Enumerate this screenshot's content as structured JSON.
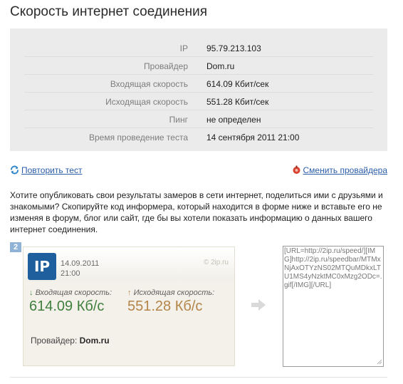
{
  "page": {
    "title": "Скорость интернет соединения"
  },
  "results": [
    {
      "label": "IP",
      "value": "95.79.213.103"
    },
    {
      "label": "Провайдер",
      "value": "Dom.ru"
    },
    {
      "label": "Входящая скорость",
      "value": "614.09 Кбит/сек"
    },
    {
      "label": "Исходящая скорость",
      "value": "551.28 Кбит/сек"
    },
    {
      "label": "Пинг",
      "value": "не определен"
    },
    {
      "label": "Время проведение теста",
      "value": "14 сентября 2011 21:00"
    }
  ],
  "links": {
    "retest": "Повторить тест",
    "change_provider": "Сменить провайдера"
  },
  "description": "Хотите опубликовать свои результаты замеров в сети интернет, поделиться ими с друзьями и знакомыми? Скопируйте код информера, который находится в форме ниже и вставьте его не изменяя в форум, блог или сайт, где бы вы хотели показать информацию о данных вашего интернет соединения.",
  "step": "2",
  "informer": {
    "logo": "IP",
    "date": "14.09.2011",
    "time": "21:00",
    "site": "© 2ip.ru",
    "down_label": "Входящая скорость:",
    "up_label": "Исходящая скорость:",
    "down_value": "614.09 Кб/с",
    "up_value": "551.28 Кб/с",
    "provider_label": "Провайдер:",
    "provider_value": "Dom.ru"
  },
  "code": "[URL=http://2ip.ru/speed/][IMG]http://2ip.ru/speedbar/MTMxNjAxOTYzNS02MTQuMDkxLTU1MS4yNzktMC0xMzg2ODc=.gif[/IMG][/URL]",
  "colors": {
    "link": "#2a5da8",
    "panel": "#ebebeb",
    "download": "#3f7f3e",
    "upload": "#b38548",
    "logo": "#1f5f9e"
  }
}
